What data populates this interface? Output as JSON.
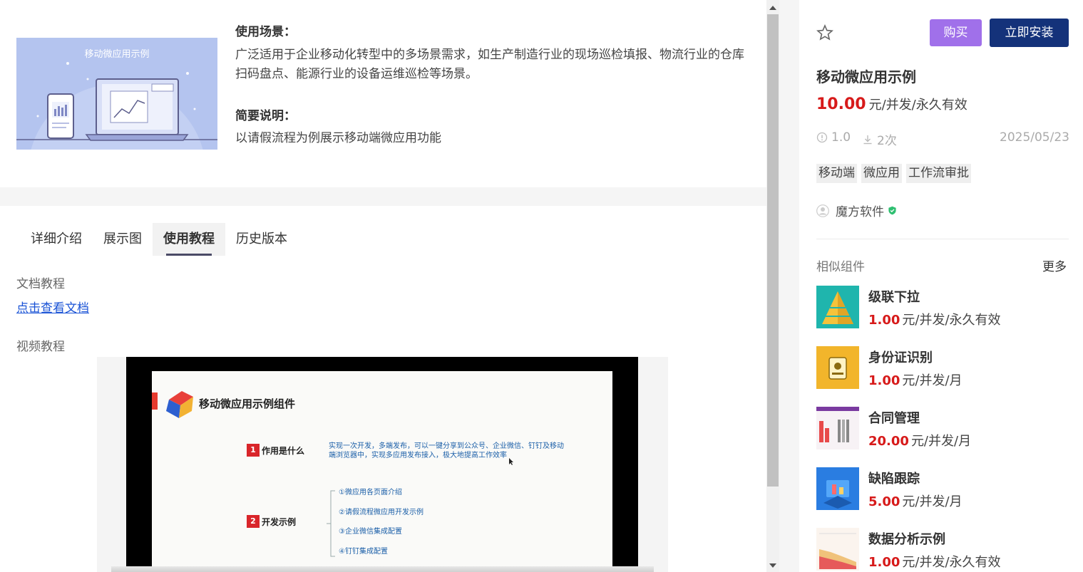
{
  "product_intro": {
    "thumbnail_title": "移动微应用示例",
    "scene_title": "使用场景：",
    "scene_text": "广泛适用于企业移动化转型中的多场景需求，如生产制造行业的现场巡检填报、物流行业的仓库扫码盘点、能源行业的设备运维巡检等场景。",
    "brief_title": "简要说明：",
    "brief_text": "以请假流程为例展示移动端微应用功能"
  },
  "tabs": [
    {
      "label": "详细介绍",
      "active": false
    },
    {
      "label": "展示图",
      "active": false
    },
    {
      "label": "使用教程",
      "active": true
    },
    {
      "label": "历史版本",
      "active": false
    }
  ],
  "tutorial": {
    "doc_label": "文档教程",
    "doc_link": "点击查看文档",
    "video_label": "视频教程"
  },
  "video_slide": {
    "title": "移动微应用示例组件",
    "item1_num": "1",
    "item1_title": "作用是什么",
    "item1_desc_line1": "实现一次开发，多端发布，可以一键分享到公众号、企业微信、钉钉及移动",
    "item1_desc_line2": "端浏览器中，实现多应用发布接入，极大地提高工作效率",
    "item2_num": "2",
    "item2_title": "开发示例",
    "item2_points": [
      "①微应用各页面介绍",
      "②请假流程微应用开发示例",
      "③企业微信集成配置",
      "④钉钉集成配置"
    ]
  },
  "sidebar": {
    "buy_label": "购买",
    "install_label": "立即安装",
    "product_name": "移动微应用示例",
    "price": "10.00",
    "price_unit": "元/并发/永久有效",
    "version": "1.0",
    "downloads": "2次",
    "date": "2025/05/23",
    "tags": [
      "移动端",
      "微应用",
      "工作流审批"
    ],
    "vendor": "魔方软件",
    "similar_title": "相似组件",
    "more_label": "更多",
    "similar": [
      {
        "name": "级联下拉",
        "price": "1.00",
        "unit": "元/并发/永久有效",
        "color": "#1fb5ad"
      },
      {
        "name": "身份证识别",
        "price": "1.00",
        "unit": "元/并发/月",
        "color": "#f2b52b"
      },
      {
        "name": "合同管理",
        "price": "20.00",
        "unit": "元/并发/月",
        "color": "#e84a4a"
      },
      {
        "name": "缺陷跟踪",
        "price": "5.00",
        "unit": "元/并发/月",
        "color": "#2a7de1"
      },
      {
        "name": "数据分析示例",
        "price": "1.00",
        "unit": "元/并发/永久有效",
        "color": "#e8a35a"
      }
    ]
  },
  "colors": {
    "accent_purple": "#a070ea",
    "accent_navy": "#14327a",
    "price_red": "#d71a1a",
    "link_blue": "#1a53d6"
  }
}
